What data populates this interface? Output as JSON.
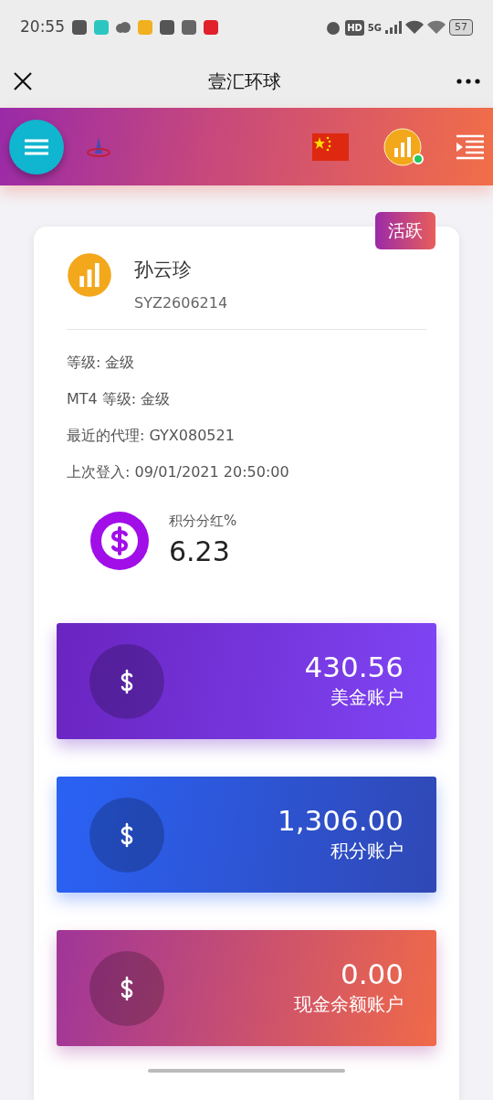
{
  "status_bar": {
    "time": "20:55",
    "network": "5G",
    "hd": "HD",
    "battery": "57"
  },
  "title_bar": {
    "title": "壹汇环球"
  },
  "header": {
    "online": true
  },
  "profile": {
    "badge": "活跃",
    "name": "孙云珍",
    "id": "SYZ2606214",
    "details": [
      "等级: 金级",
      "MT4 等级: 金级",
      "最近的代理: GYX080521",
      "上次登入: 09/01/2021 20:50:00"
    ],
    "stat": {
      "label": "积分分红%",
      "value": "6.23"
    }
  },
  "accounts": [
    {
      "kind": "usd",
      "amount": "430.56",
      "label": "美金账户"
    },
    {
      "kind": "points",
      "amount": "1,306.00",
      "label": "积分账户"
    },
    {
      "kind": "cash",
      "amount": "0.00",
      "label": "现金余额账户"
    }
  ]
}
